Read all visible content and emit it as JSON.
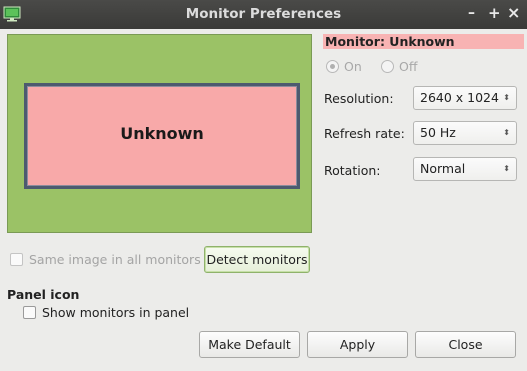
{
  "window": {
    "title": "Monitor Preferences",
    "icon": "monitor-app-icon",
    "controls": {
      "minimize": "–",
      "maximize": "+",
      "close": "×"
    }
  },
  "preview": {
    "monitor_label": "Unknown",
    "background_color": "#9bc266",
    "monitor_color": "#f8a9a9"
  },
  "monitor_settings": {
    "title": "Monitor: Unknown",
    "power": {
      "on_label": "On",
      "off_label": "Off",
      "selected": "On",
      "enabled": false
    },
    "resolution": {
      "label": "Resolution:",
      "value": "2640 x 1024"
    },
    "refresh_rate": {
      "label": "Refresh rate:",
      "value": "50 Hz"
    },
    "rotation": {
      "label": "Rotation:",
      "value": "Normal"
    }
  },
  "same_image": {
    "label": "Same image in all monitors",
    "checked": false,
    "enabled": false
  },
  "detect_button": "Detect monitors",
  "panel_icon": {
    "section_title": "Panel icon",
    "show_label": "Show monitors in panel",
    "checked": false
  },
  "buttons": {
    "make_default": "Make Default",
    "apply": "Apply",
    "close": "Close"
  }
}
